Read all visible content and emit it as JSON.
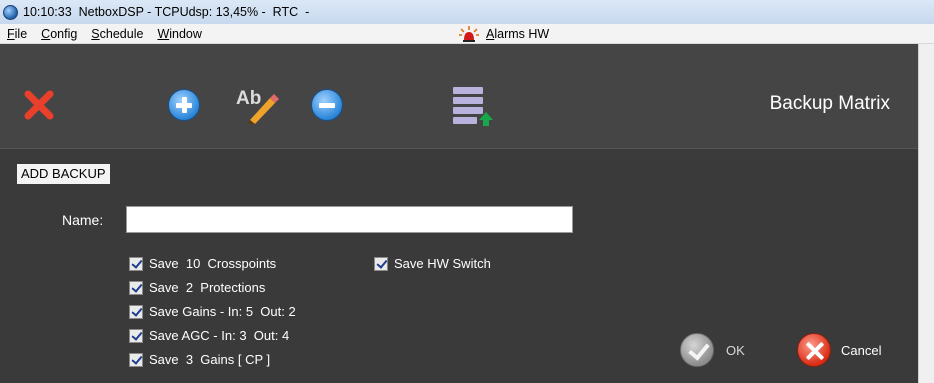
{
  "window": {
    "title": "10:10:33  NetboxDSP - TCPUdsp: 13,45% -  RTC  -"
  },
  "menu": {
    "items": [
      {
        "accel": "F",
        "rest": "ile"
      },
      {
        "accel": "C",
        "rest": "onfig"
      },
      {
        "accel": "S",
        "rest": "chedule"
      },
      {
        "accel": "W",
        "rest": "indow"
      }
    ],
    "alarm": {
      "accel": "A",
      "rest": "larms HW"
    }
  },
  "toolbar": {
    "title": "Backup Matrix",
    "icons": [
      "close-icon",
      "add-icon",
      "rename-icon",
      "remove-icon",
      "load-list-icon"
    ]
  },
  "form": {
    "section_label": "ADD BACKUP",
    "name_label": "Name:",
    "name_value": "",
    "checkboxes": [
      {
        "label": "Save  10  Crosspoints",
        "checked": true
      },
      {
        "label": "Save  2  Protections",
        "checked": true
      },
      {
        "label": "Save Gains - In: 5  Out: 2",
        "checked": true
      },
      {
        "label": "Save AGC - In: 3  Out: 4",
        "checked": true
      },
      {
        "label": "Save  3  Gains [ CP ]",
        "checked": true
      }
    ],
    "hw_switch": {
      "label": "Save HW Switch",
      "checked": true
    },
    "ok_label": "OK",
    "cancel_label": "Cancel"
  },
  "colors": {
    "panel": "#414141",
    "form_bg": "#3a3a3a",
    "accent_blue": "#2a86d8",
    "cancel_red": "#d92d16"
  }
}
